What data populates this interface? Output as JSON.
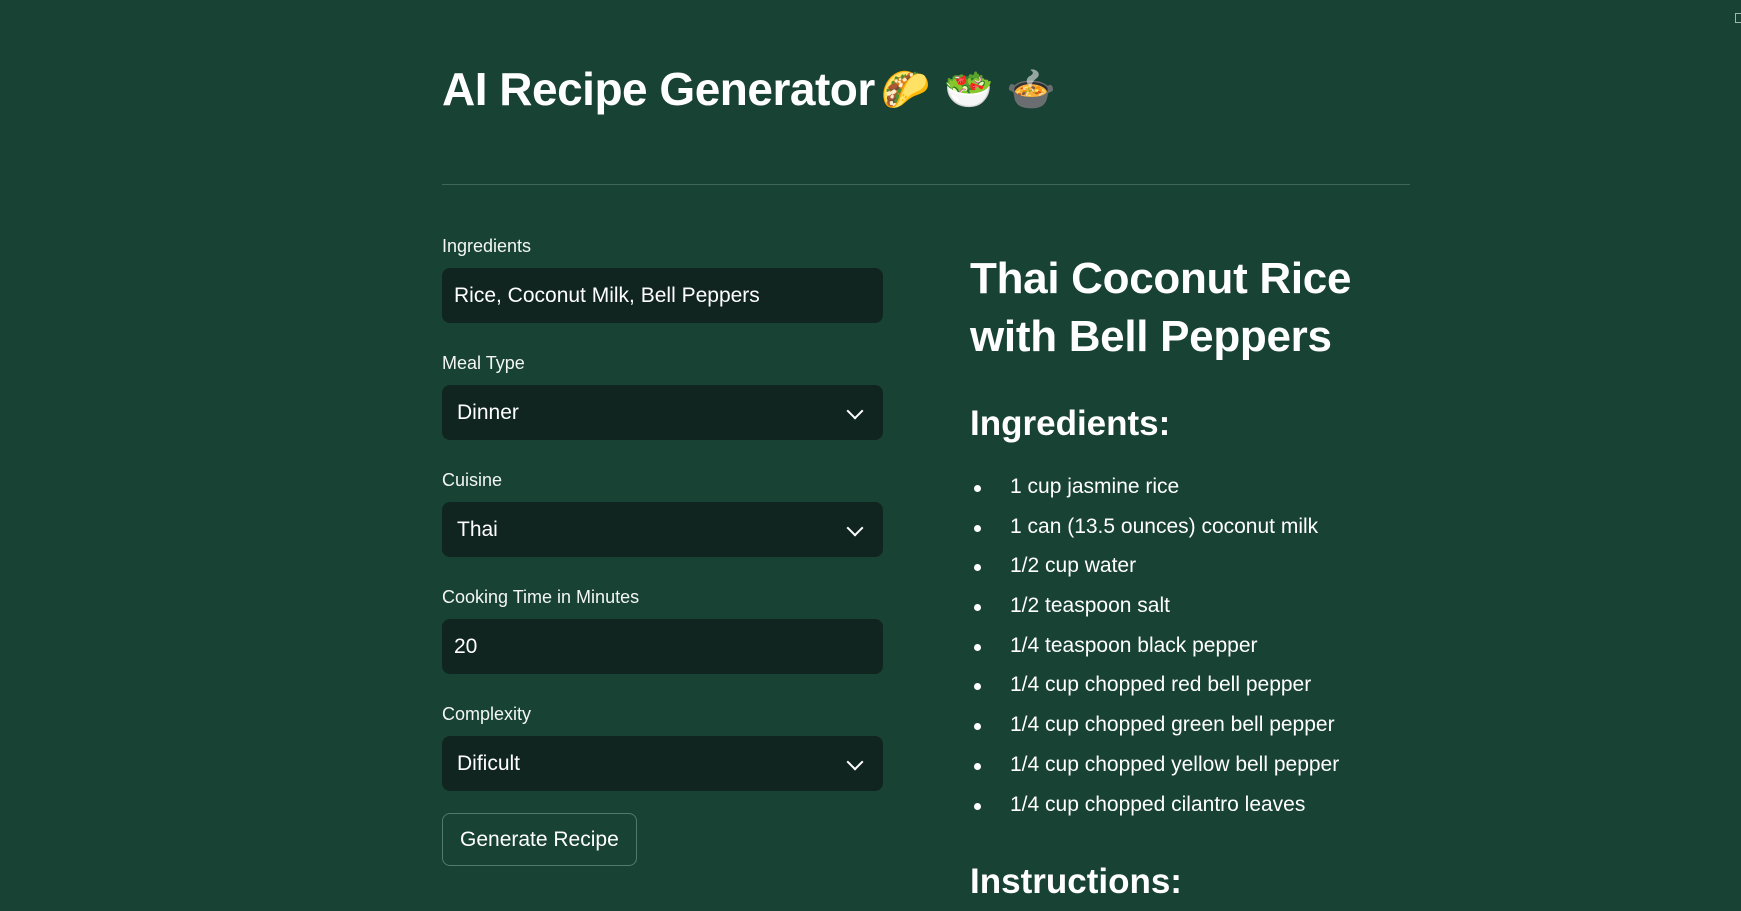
{
  "app": {
    "title": "AI Recipe Generator",
    "title_emojis": "🌮 🥗 🍲"
  },
  "form": {
    "ingredients": {
      "label": "Ingredients",
      "value": "Rice, Coconut Milk, Bell Peppers"
    },
    "meal_type": {
      "label": "Meal Type",
      "value": "Dinner"
    },
    "cuisine": {
      "label": "Cuisine",
      "value": "Thai"
    },
    "cooking_time": {
      "label": "Cooking Time in Minutes",
      "value": "20"
    },
    "complexity": {
      "label": "Complexity",
      "value": "Dificult"
    },
    "submit_label": "Generate Recipe"
  },
  "recipe": {
    "title_line1": "Thai Coconut Rice",
    "title_line2": "with Bell Peppers",
    "ingredients_heading": "Ingredients:",
    "ingredients": [
      "1 cup jasmine rice",
      "1 can (13.5 ounces) coconut milk",
      "1/2 cup water",
      "1/2 teaspoon salt",
      "1/4 teaspoon black pepper",
      "1/4 cup chopped red bell pepper",
      "1/4 cup chopped green bell pepper",
      "1/4 cup chopped yellow bell pepper",
      "1/4 cup chopped cilantro leaves"
    ],
    "instructions_heading": "Instructions:"
  },
  "icons": {
    "dropdown": "chevron-down-icon",
    "list_bullet": "bullet-icon"
  },
  "colors": {
    "background": "#184233",
    "input_background": "#102520",
    "text": "#ffffff",
    "divider": "#3f6658",
    "button_border": "#4d7d6a"
  }
}
